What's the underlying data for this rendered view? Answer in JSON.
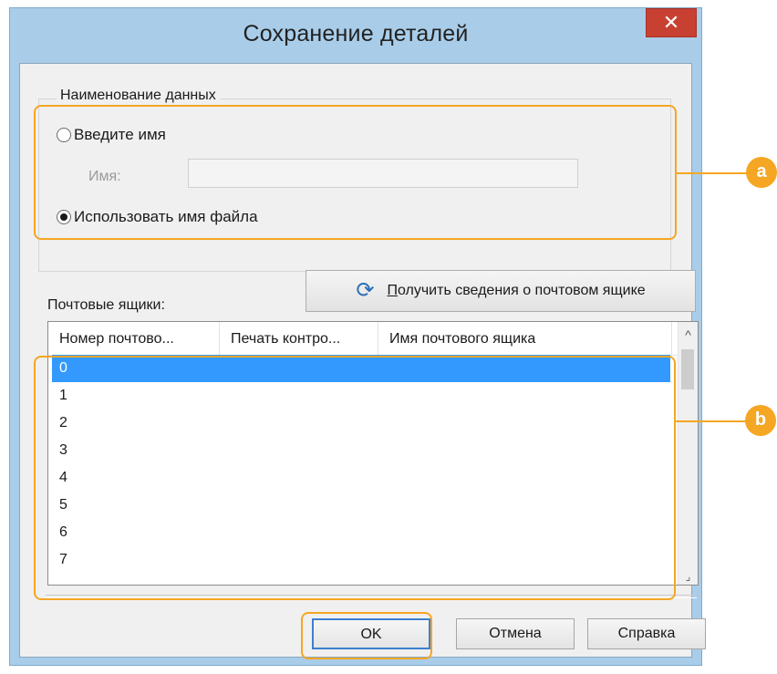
{
  "window": {
    "title": "Сохранение деталей",
    "close_label": "✕"
  },
  "group": {
    "legend": "Наименование данных",
    "radio_enter_name": "Введите имя",
    "name_label": "Имя:",
    "name_value": "",
    "radio_use_filename": "Использовать имя файла",
    "selected_option": "use_filename"
  },
  "get_info_button": {
    "underlined_char": "П",
    "label_rest": "олучить сведения о почтовом ящике",
    "icon": "refresh-icon"
  },
  "mailboxes": {
    "caption": "Почтовые ящики:",
    "columns": [
      "Номер почтово...",
      "Печать контро...",
      "Имя почтового ящика"
    ],
    "rows": [
      "0",
      "1",
      "2",
      "3",
      "4",
      "5",
      "6",
      "7"
    ],
    "selected_row": "0"
  },
  "buttons": {
    "ok": "OK",
    "cancel": "Отмена",
    "help": "Справка"
  },
  "callouts": {
    "a": "a",
    "b": "b"
  },
  "colors": {
    "callout": "#f5a623",
    "selection": "#3399ff",
    "close": "#c84031"
  }
}
